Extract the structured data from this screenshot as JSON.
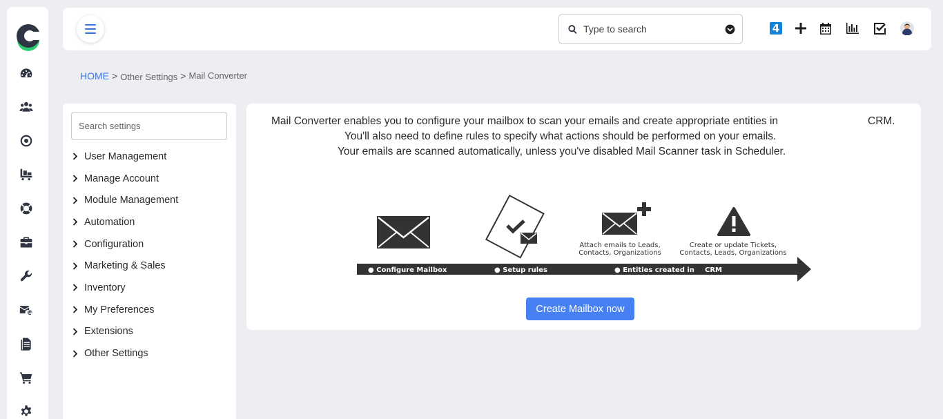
{
  "topbar": {
    "search_placeholder": "Type to search",
    "badge_count": "4"
  },
  "breadcrumb": {
    "home": "HOME",
    "sep1": ">",
    "item1": "Other Settings",
    "sep2": ">",
    "item2": "Mail Converter"
  },
  "settings": {
    "search_placeholder": "Search settings",
    "items": [
      {
        "label": "User Management"
      },
      {
        "label": "Manage Account"
      },
      {
        "label": "Module Management"
      },
      {
        "label": "Automation"
      },
      {
        "label": "Configuration"
      },
      {
        "label": "Marketing & Sales"
      },
      {
        "label": "Inventory"
      },
      {
        "label": "My Preferences"
      },
      {
        "label": "Extensions"
      },
      {
        "label": "Other Settings"
      }
    ]
  },
  "content": {
    "line1": "Mail Converter enables you to configure your mailbox to scan your emails and create appropriate entities in",
    "line1_crm": "CRM.",
    "line2": "You'll also need to define rules to specify what actions should be performed on your emails.",
    "line3": "Your emails are scanned automatically, unless you've disabled Mail Scanner task in Scheduler.",
    "diagram": {
      "step1": "● Configure Mailbox",
      "step2": "● Setup rules",
      "step3": "● Entities created in",
      "step3b": "CRM",
      "cap3a": "Attach emails to Leads,",
      "cap3b": "Contacts, Organizations",
      "cap4a": "Create or update Tickets,",
      "cap4b": "Contacts, Leads, Organizations"
    },
    "create_button": "Create Mailbox now"
  },
  "colors": {
    "accent": "#3a78e8",
    "button": "#4680f2",
    "logo_green": "#2ecc71",
    "logo_dark": "#2f3542"
  }
}
